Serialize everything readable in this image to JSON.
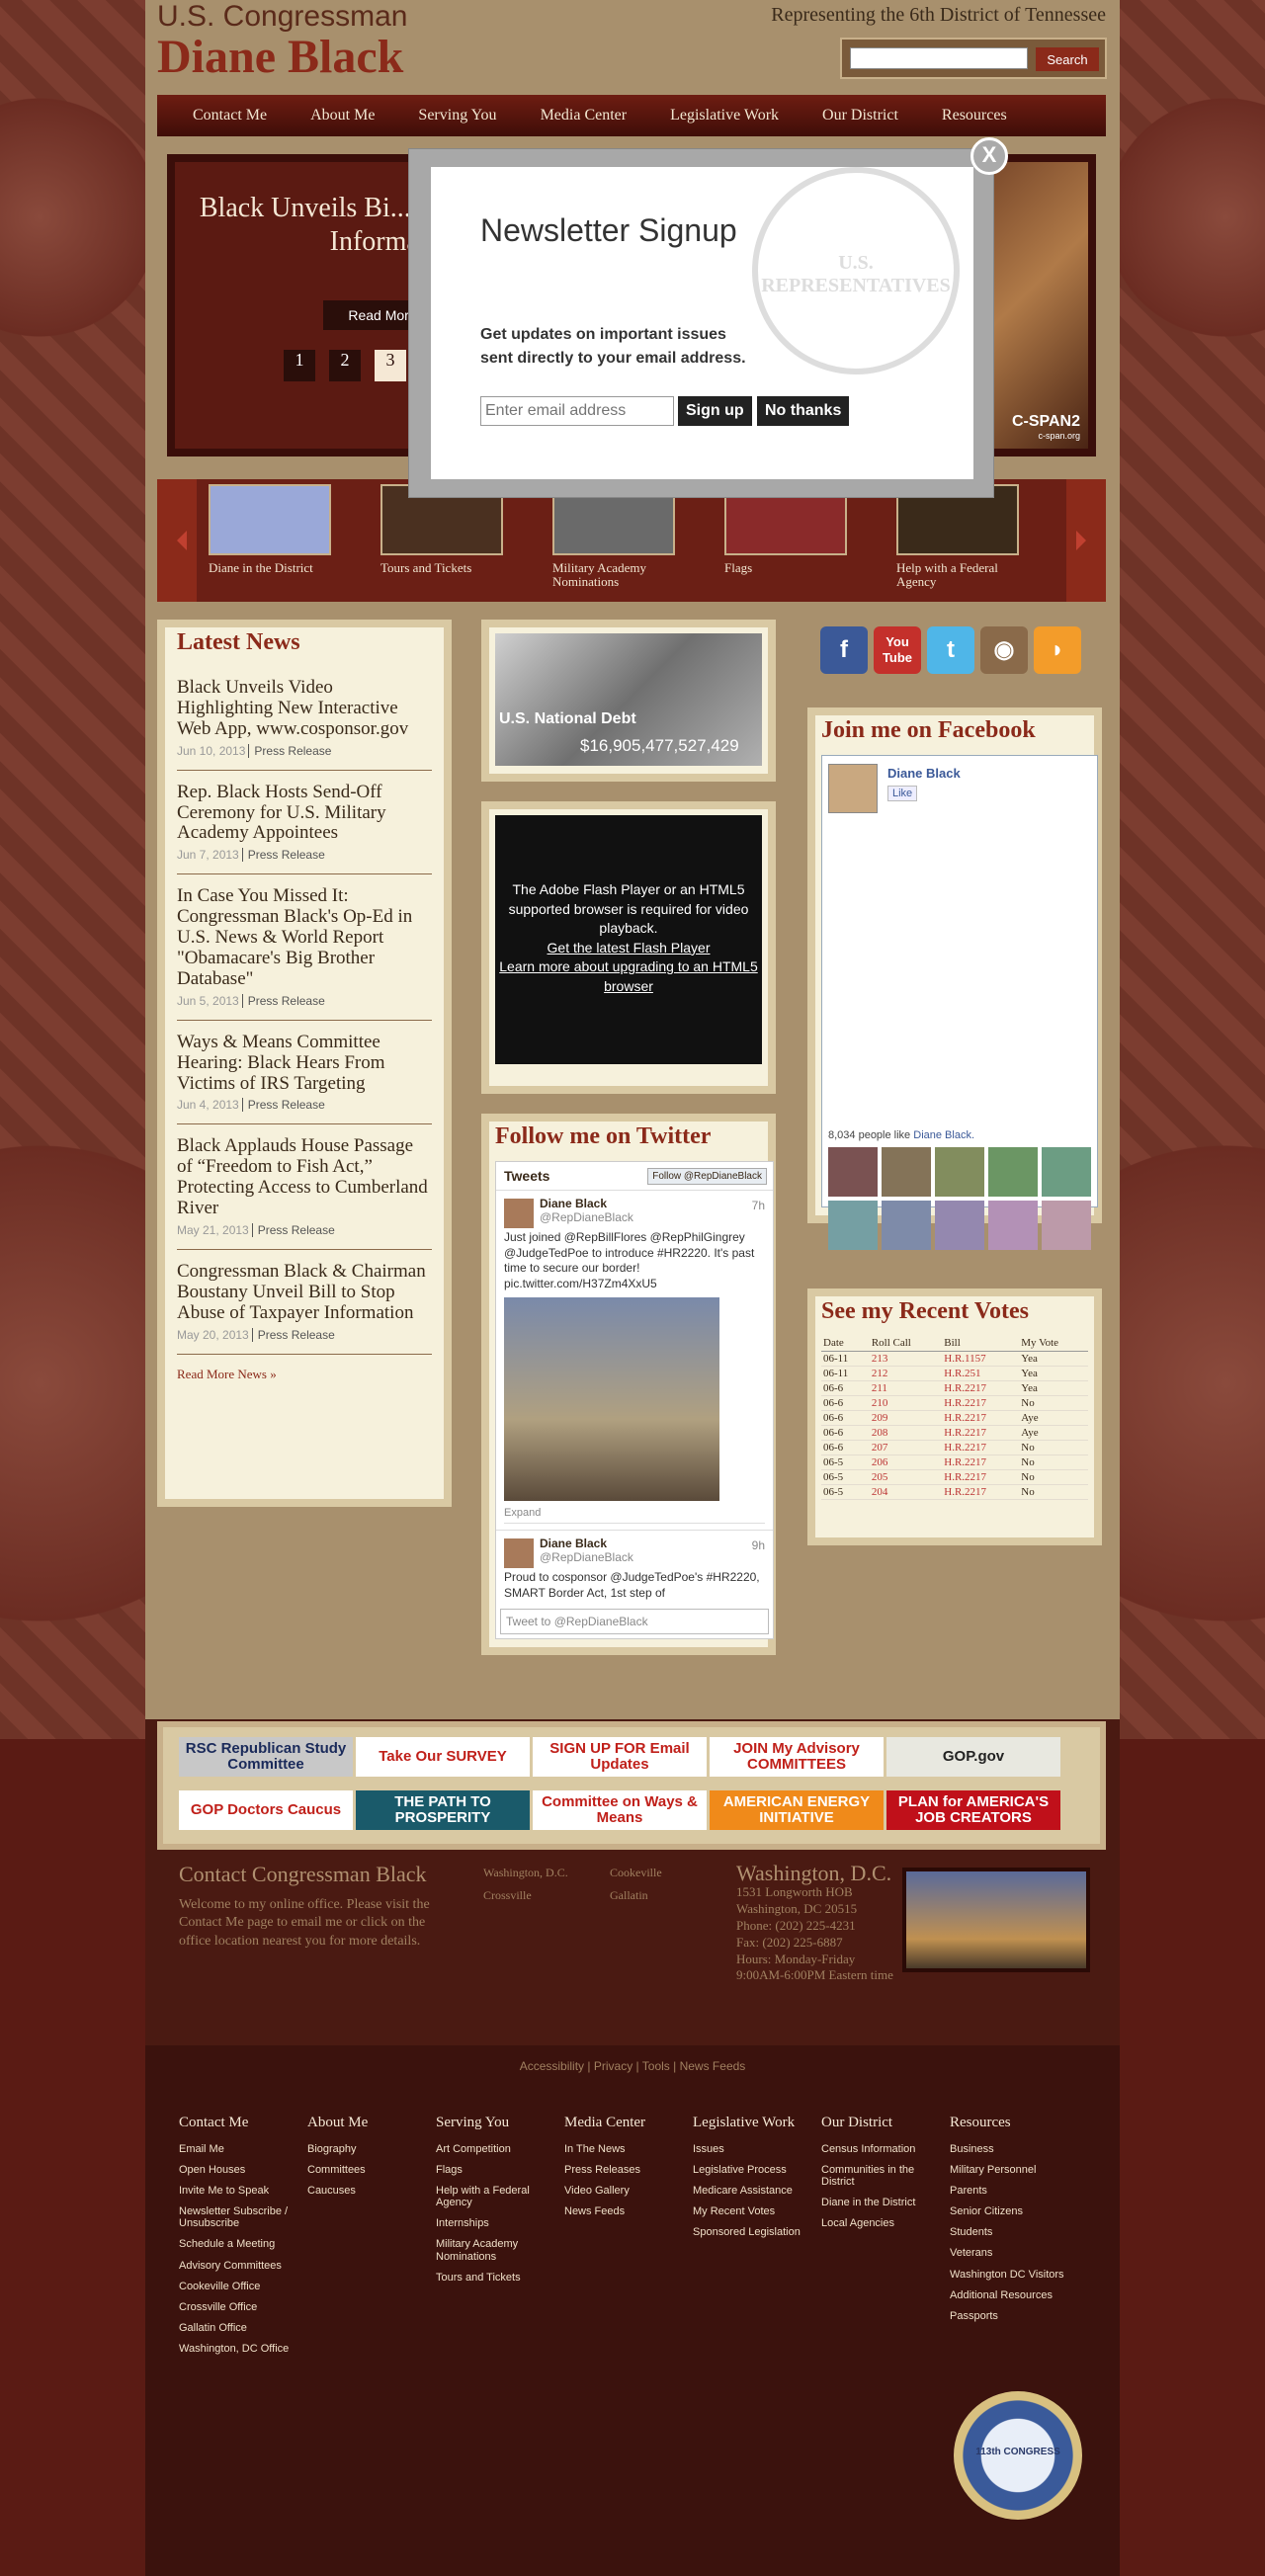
{
  "header": {
    "line1": "U.S. Congressman",
    "name": "Diane Black",
    "district": "Representing the 6th District of Tennessee",
    "search_button": "Search"
  },
  "nav": [
    "Contact Me",
    "About Me",
    "Serving You",
    "Media Center",
    "Legislative Work",
    "Our District",
    "Resources"
  ],
  "slider": {
    "title": "Black Unveils Bi... Abuse of Tax... Informati...",
    "read_more": "Read More",
    "pages": [
      "1",
      "2",
      "3"
    ],
    "cspan": "C-SPAN2",
    "cspan_url": "c-span.org"
  },
  "thumbs": [
    "Diane in the District",
    "Tours and Tickets",
    "Military Academy Nominations",
    "Flags",
    "Help with a Federal Agency"
  ],
  "news": {
    "heading": "Latest News",
    "items": [
      {
        "title": "Black Unveils Video Highlighting New Interactive Web App, www.cosponsor.gov",
        "date": "Jun 10, 2013",
        "type": "Press Release"
      },
      {
        "title": "Rep. Black Hosts Send-Off Ceremony for U.S. Military Academy Appointees",
        "date": "Jun 7, 2013",
        "type": "Press Release"
      },
      {
        "title": "In Case You Missed It: Congressman Black's Op-Ed in U.S. News & World Report \"Obamacare's Big Brother Database\"",
        "date": "Jun 5, 2013",
        "type": "Press Release"
      },
      {
        "title": "Ways & Means Committee Hearing: Black Hears From Victims of IRS Targeting",
        "date": "Jun 4, 2013",
        "type": "Press Release"
      },
      {
        "title": "Black Applauds House Passage of “Freedom to Fish Act,” Protecting Access to Cumberland River",
        "date": "May 21, 2013",
        "type": "Press Release"
      },
      {
        "title": "Congressman Black & Chairman Boustany Unveil Bill to Stop Abuse of Taxpayer Information",
        "date": "May 20, 2013",
        "type": "Press Release"
      }
    ],
    "more": "Read More News »"
  },
  "debt": {
    "label": "U.S. National Debt",
    "value": "$16,905,477,527,429"
  },
  "flash": {
    "msg": "The Adobe Flash Player or an HTML5 supported browser is required for video playback.",
    "link1": "Get the latest Flash Player",
    "link2": "Learn more about upgrading to an HTML5 browser"
  },
  "twitter": {
    "heading": "Follow me on Twitter",
    "tweets_label": "Tweets",
    "follow": "Follow @RepDianeBlack",
    "t1": {
      "name": "Diane Black",
      "handle": "@RepDianeBlack",
      "time": "7h",
      "text": "Just joined @RepBillFlores @RepPhilGingrey @JudgeTedPoe to introduce #HR2220. It's past time to secure our border! pic.twitter.com/H37Zm4XxU5"
    },
    "expand": "Expand",
    "t2": {
      "name": "Diane Black",
      "handle": "@RepDianeBlack",
      "time": "9h",
      "text": "Proud to cosponsor @JudgeTedPoe's #HR2220, SMART Border Act, 1st step of"
    },
    "input": "Tweet to @RepDianeBlack"
  },
  "social": [
    {
      "icon": "facebook-icon",
      "glyph": "f",
      "color": "#3b5998"
    },
    {
      "icon": "youtube-icon",
      "glyph": "You Tube",
      "color": "#c4302b"
    },
    {
      "icon": "twitter-icon",
      "glyph": "t",
      "color": "#4fb6e8"
    },
    {
      "icon": "instagram-icon",
      "glyph": "◉",
      "color": "#8a6a4a"
    },
    {
      "icon": "rss-icon",
      "glyph": "◗",
      "color": "#f39c2a"
    }
  ],
  "facebook": {
    "heading": "Join me on Facebook",
    "page": "Diane Black",
    "like": "Like",
    "count": "8,034 people like",
    "count_link": "Diane Black."
  },
  "votes": {
    "heading": "See my Recent Votes",
    "cols": [
      "Date",
      "Roll Call",
      "Bill",
      "My Vote"
    ],
    "rows": [
      [
        "06-11",
        "213",
        "H.R.1157",
        "Yea"
      ],
      [
        "06-11",
        "212",
        "H.R.251",
        "Yea"
      ],
      [
        "06-6",
        "211",
        "H.R.2217",
        "Yea"
      ],
      [
        "06-6",
        "210",
        "H.R.2217",
        "No"
      ],
      [
        "06-6",
        "209",
        "H.R.2217",
        "Aye"
      ],
      [
        "06-6",
        "208",
        "H.R.2217",
        "Aye"
      ],
      [
        "06-6",
        "207",
        "H.R.2217",
        "No"
      ],
      [
        "06-5",
        "206",
        "H.R.2217",
        "No"
      ],
      [
        "06-5",
        "205",
        "H.R.2217",
        "No"
      ],
      [
        "06-5",
        "204",
        "H.R.2217",
        "No"
      ]
    ]
  },
  "banners": [
    {
      "text": "RSC Republican Study Committee",
      "bg": "#c8c8c8",
      "fg": "#1a2a5a"
    },
    {
      "text": "Take Our SURVEY",
      "bg": "#ffffff",
      "fg": "#c0201a"
    },
    {
      "text": "SIGN UP FOR Email Updates",
      "bg": "#ffffff",
      "fg": "#c0201a"
    },
    {
      "text": "JOIN My Advisory COMMITTEES",
      "bg": "#ffffff",
      "fg": "#c0201a"
    },
    {
      "text": "GOP.gov",
      "bg": "#e8e8e0",
      "fg": "#222"
    },
    {
      "text": "GOP Doctors Caucus",
      "bg": "#ffffff",
      "fg": "#c0201a"
    },
    {
      "text": "THE PATH TO PROSPERITY",
      "bg": "#1a5a6a",
      "fg": "#ffffff"
    },
    {
      "text": "Committee on Ways & Means",
      "bg": "#ffffff",
      "fg": "#c0201a"
    },
    {
      "text": "AMERICAN ENERGY INITIATIVE",
      "bg": "#f08a1a",
      "fg": "#ffffff"
    },
    {
      "text": "PLAN for AMERICA'S JOB CREATORS",
      "bg": "#c0101a",
      "fg": "#ffffff"
    }
  ],
  "contact": {
    "heading": "Contact Congressman Black",
    "text": "Welcome to my online office. Please visit the Contact Me page to email me or click on the office location nearest you for more details.",
    "offices": [
      "Washington, D.C.",
      "Cookeville",
      "Crossville",
      "Gallatin"
    ]
  },
  "dc": {
    "heading": "Washington, D.C.",
    "lines": [
      "1531 Longworth HOB",
      "Washington, DC 20515",
      "Phone: (202) 225-4231",
      "Fax: (202) 225-6887",
      "Hours: Monday-Friday",
      "9:00AM-6:00PM Eastern time"
    ]
  },
  "util": [
    "Accessibility",
    "Privacy",
    "Tools",
    "News Feeds"
  ],
  "footer": [
    {
      "h": "Contact Me",
      "items": [
        "Email Me",
        "Open Houses",
        "Invite Me to Speak",
        "Newsletter Subscribe / Unsubscribe",
        "Schedule a Meeting",
        "Advisory Committees",
        "Cookeville Office",
        "Crossville Office",
        "Gallatin Office",
        "Washington, DC Office"
      ]
    },
    {
      "h": "About Me",
      "items": [
        "Biography",
        "Committees",
        "Caucuses"
      ]
    },
    {
      "h": "Serving You",
      "items": [
        "Art Competition",
        "Flags",
        "Help with a Federal Agency",
        "Internships",
        "Military Academy Nominations",
        "Tours and Tickets"
      ]
    },
    {
      "h": "Media Center",
      "items": [
        "In The News",
        "Press Releases",
        "Video Gallery",
        "News Feeds"
      ]
    },
    {
      "h": "Legislative Work",
      "items": [
        "Issues",
        "Legislative Process",
        "Medicare Assistance",
        "My Recent Votes",
        "Sponsored Legislation"
      ]
    },
    {
      "h": "Our District",
      "items": [
        "Census Information",
        "Communities in the District",
        "Diane in the District",
        "Local Agencies"
      ]
    },
    {
      "h": "Resources",
      "items": [
        "Business",
        "Military Personnel",
        "Parents",
        "Senior Citizens",
        "Students",
        "Veterans",
        "Washington DC Visitors",
        "Additional Resources",
        "Passports"
      ]
    }
  ],
  "seal": "113th CONGRESS",
  "modal": {
    "title": "Newsletter Signup",
    "text": "Get updates on important issues sent directly to your email address.",
    "placeholder": "Enter email address",
    "signup": "Sign up",
    "nothanks": "No thanks",
    "close": "X"
  }
}
